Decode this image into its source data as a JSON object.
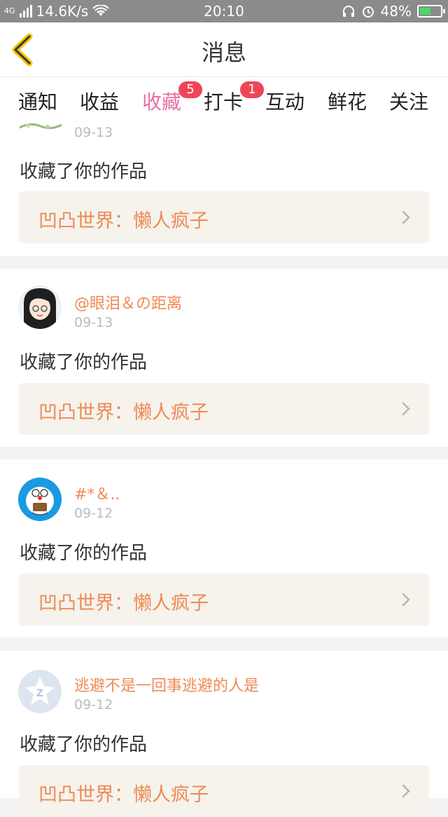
{
  "status_bar": {
    "network": "4G",
    "speed": "14.6K/s",
    "time": "20:10",
    "battery": "48%"
  },
  "header": {
    "title": "消息"
  },
  "tabs": [
    {
      "label": "通知",
      "badge": ""
    },
    {
      "label": "收益",
      "badge": ""
    },
    {
      "label": "收藏",
      "badge": "5",
      "active": true
    },
    {
      "label": "打卡",
      "badge": "1"
    },
    {
      "label": "互动",
      "badge": ""
    },
    {
      "label": "鲜花",
      "badge": ""
    },
    {
      "label": "关注",
      "badge": ""
    }
  ],
  "messages": [
    {
      "user": "",
      "date": "09-13",
      "action": "收藏了你的作品",
      "work": "凹凸世界：懒人疯子"
    },
    {
      "user": "@眼泪＆の距离",
      "date": "09-13",
      "action": "收藏了你的作品",
      "work": "凹凸世界：懒人疯子"
    },
    {
      "user": "#*＆..",
      "date": "09-12",
      "action": "收藏了你的作品",
      "work": "凹凸世界：懒人疯子"
    },
    {
      "user": "逃避不是一回事逃避的人是",
      "date": "09-12",
      "action": "收藏了你的作品",
      "work": "凹凸世界：懒人疯子"
    }
  ],
  "colors": {
    "accent": "#e870a0",
    "badge": "#ee4657",
    "username": "#ee8a55",
    "work_bg": "#f5f3ec"
  }
}
